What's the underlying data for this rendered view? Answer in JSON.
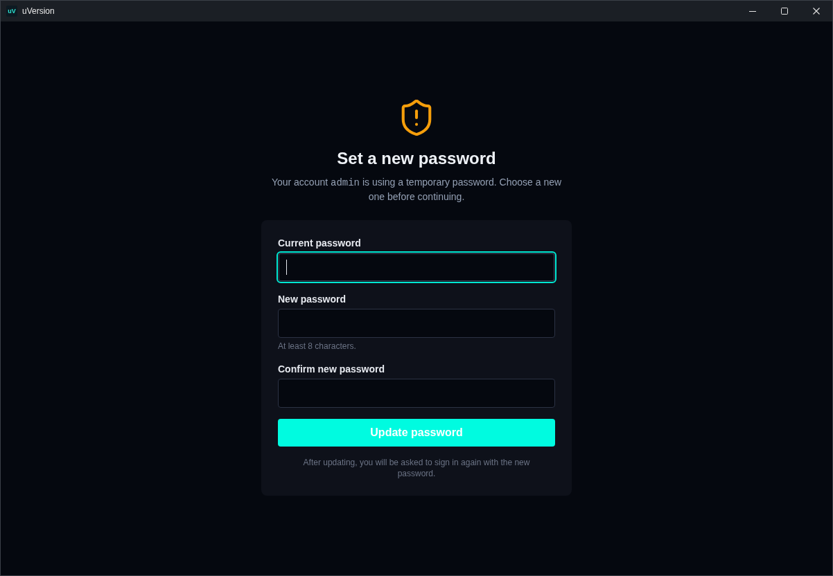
{
  "window": {
    "logo_text": "uV",
    "title": "uVersion",
    "controls": [
      {
        "kind": "minimize"
      },
      {
        "kind": "maximize"
      },
      {
        "kind": "close"
      }
    ]
  },
  "page": {
    "heading": "Set a new password",
    "description": [
      {
        "kind": "plain",
        "text": "Your account "
      },
      {
        "kind": "code",
        "text": "admin"
      },
      {
        "kind": "plain",
        "text": " is using a temporary password. Choose a new one before continuing."
      }
    ]
  },
  "form": {
    "fields": [
      {
        "label": "Current password",
        "focused": true
      },
      {
        "label": "New password",
        "focused": false,
        "hint": "At least 8 characters."
      },
      {
        "label": "Confirm new password",
        "focused": false
      }
    ],
    "submit": "Update password",
    "footnote": "After updating, you will be asked to sign in again with the new password."
  }
}
